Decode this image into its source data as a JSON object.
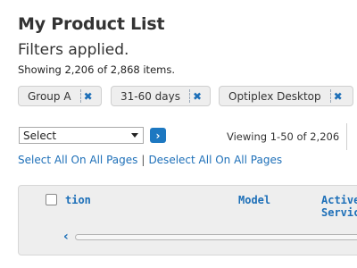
{
  "page": {
    "title": "My Product List",
    "filters_applied": "Filters applied.",
    "showing": "Showing 2,206 of 2,868 items."
  },
  "filters": [
    {
      "label": "Group A",
      "remove": "✖"
    },
    {
      "label": "31-60 days",
      "remove": "✖"
    },
    {
      "label": "Optiplex Desktop",
      "remove": "✖"
    }
  ],
  "actions": {
    "select_value": "Select",
    "go_icon": "chevron-right-icon",
    "go_glyph": "›",
    "viewing": "Viewing 1-50 of 2,206"
  },
  "links": {
    "select_all": "Select All On All Pages",
    "separator": "|",
    "deselect_all": "Deselect All On All Pages"
  },
  "table": {
    "columns": [
      "tion",
      "Model",
      "Active",
      "Servic"
    ],
    "scroll_left_glyph": "‹"
  },
  "colors": {
    "link": "#1d6fb8",
    "button": "#1d78c1",
    "chip_bg": "#eeeeee",
    "table_bg": "#eeeeee"
  }
}
